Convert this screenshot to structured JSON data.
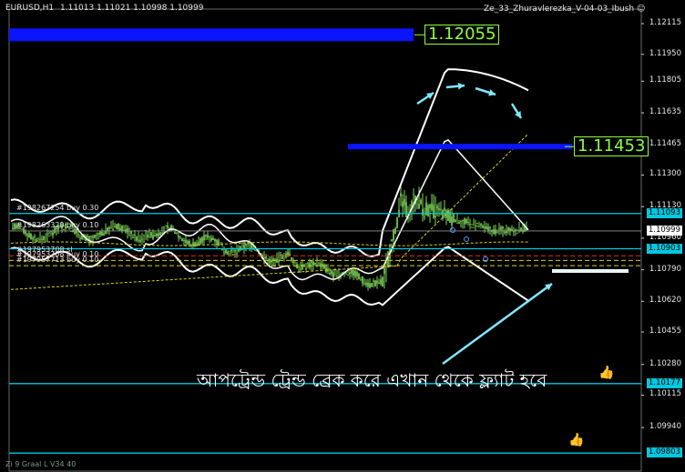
{
  "header": {
    "symbol": "EURUSD,H1",
    "ohlc": "1.11013 1.11021 1.10998 1.10999",
    "indicator": "Ze_33_Zhuravlerezka_V-04-03_Ibush",
    "smiley": "☺"
  },
  "axis": {
    "min": 1.0975,
    "max": 1.1212,
    "labels": [
      "1.12115",
      "1.11950",
      "1.11805",
      "1.11635",
      "1.11465",
      "1.11300",
      "1.11130",
      "1.10960",
      "1.10790",
      "1.10620",
      "1.10455",
      "1.10280",
      "1.10115",
      "1.09940"
    ]
  },
  "price_tags": [
    {
      "label": "1.11093",
      "value": 1.11093,
      "bg": "#00c8e0",
      "fg": "#000000"
    },
    {
      "label": "1.10999",
      "value": 1.10999,
      "bg": "#ffffff",
      "fg": "#000000"
    },
    {
      "label": "1.10903",
      "value": 1.10903,
      "bg": "#00c8e0",
      "fg": "#000000"
    },
    {
      "label": "1.10177",
      "value": 1.10177,
      "bg": "#00c8e0",
      "fg": "#000000"
    },
    {
      "label": "1.09803",
      "value": 1.09803,
      "bg": "#00c8e0",
      "fg": "#000000"
    }
  ],
  "levels": {
    "upper_zone": {
      "label": "1.12055",
      "value": 1.12055,
      "color": "#0a14ff"
    },
    "mid_zone": {
      "label": "1.11453",
      "value": 1.11453,
      "color": "#0a14ff"
    }
  },
  "orders": [
    {
      "label": "#198267254 buy 0.30",
      "value": 1.11093
    },
    {
      "label": "#198263320 buy 0.10",
      "value": 1.10999
    },
    {
      "label": "#197953708 sl",
      "value": 1.10865
    },
    {
      "label": "#197953708 buy 0.10",
      "value": 1.1084
    },
    {
      "label": "#197957713 buy 0.10",
      "value": 1.10812
    }
  ],
  "annotation_text": "আপট্রেন্ড ট্রেন্ড ব্রেক করে এখান থেকে ফ্ল্যাট হবে",
  "footer_text": "Zi 9 Graal L V34 40",
  "colors": {
    "background": "#000000",
    "candle_up": "#7ed957",
    "cyan_line": "#00c8e0",
    "band": "#ffffff",
    "arrow": "#7fe8ff",
    "dashed_yellow": "#d8d020",
    "dashed_red": "#d83020"
  },
  "icons": [
    "thumbs-up-icon",
    "smiley-icon"
  ]
}
